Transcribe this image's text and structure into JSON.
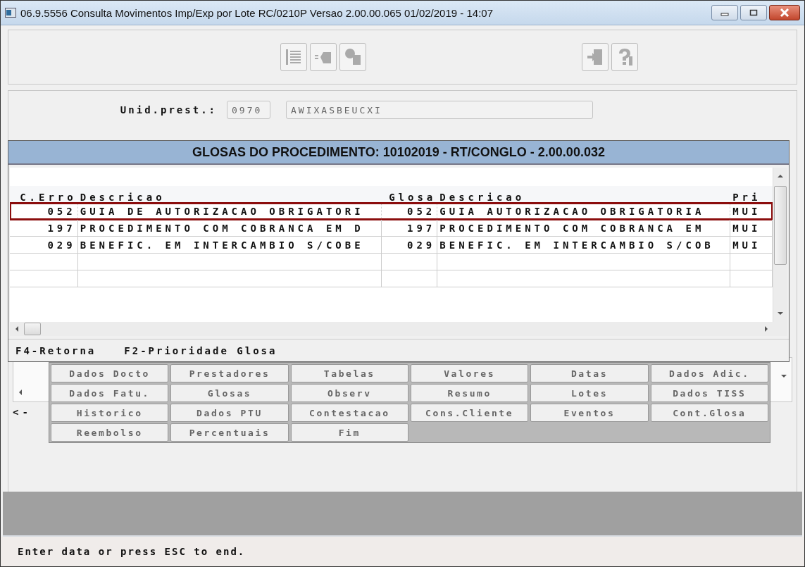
{
  "window": {
    "title": "06.9.5556 Consulta Movimentos Imp/Exp por Lote RC/0210P Versao 2.00.00.065 01/02/2019 - 14:07"
  },
  "form": {
    "label": "Unid.prest.:",
    "code": "0970",
    "name": "AWIXASBEUCXI"
  },
  "popup": {
    "title": "GLOSAS DO PROCEDIMENTO: 10102019 - RT/CONGLO - 2.00.00.032",
    "columns": [
      "C.Erro",
      "Descricao",
      "Glosa",
      "Descricao",
      "Pri"
    ],
    "rows": [
      {
        "cells": [
          "052",
          "GUIA DE AUTORIZACAO OBRIGATORI",
          "052",
          "GUIA AUTORIZACAO OBRIGATORIA",
          "MUI"
        ],
        "selected": true
      },
      {
        "cells": [
          "197",
          "PROCEDIMENTO COM COBRANCA EM D",
          "197",
          "PROCEDIMENTO COM COBRANCA EM",
          "MUI"
        ],
        "selected": false
      },
      {
        "cells": [
          "029",
          "BENEFIC. EM INTERCAMBIO S/COBE",
          "029",
          "BENEFIC. EM INTERCAMBIO S/COB",
          "MUI"
        ],
        "selected": false
      }
    ],
    "hints": [
      "F4-Retorna",
      "F2-Prioridade Glosa"
    ]
  },
  "menu": [
    "Dados Docto",
    "Prestadores",
    "Tabelas",
    "Valores",
    "Datas",
    "Dados Adic.",
    "Dados Fatu.",
    "Glosas",
    "Observ",
    "Resumo",
    "Lotes",
    "Dados TISS",
    "Historico",
    "Dados PTU",
    "Contestacao",
    "Cons.Cliente",
    "Eventos",
    "Cont.Glosa",
    "Reembolso",
    "Percentuais",
    "Fim"
  ],
  "nav_hint": "<-",
  "status_bar": "Enter data or press ESC to end."
}
